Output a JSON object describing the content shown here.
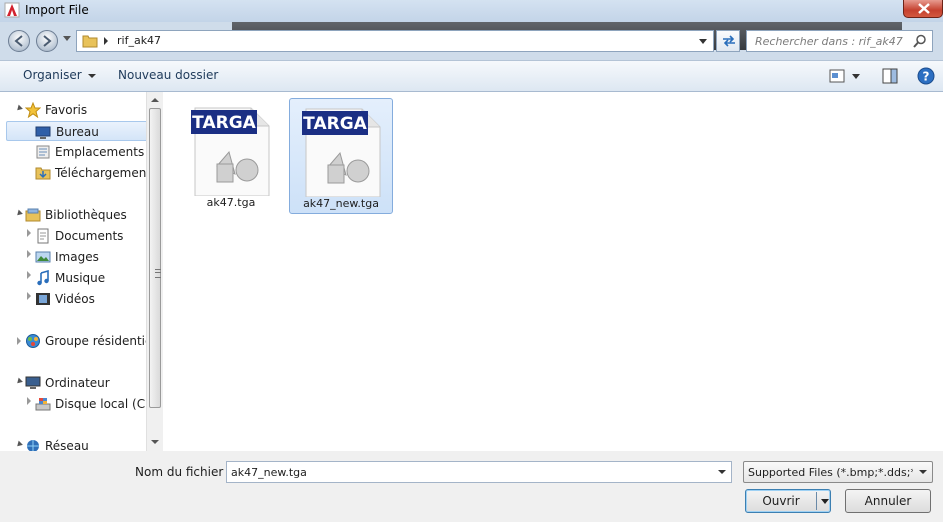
{
  "window": {
    "title": "Import File",
    "accent_color": "#cfdcea",
    "close_icon": "close-icon"
  },
  "address": {
    "path": "rif_ak47",
    "search_placeholder": "Rechercher dans : rif_ak47"
  },
  "toolbar": {
    "organize_label": "Organiser",
    "new_folder_label": "Nouveau dossier"
  },
  "navigation": {
    "favorites": {
      "label": "Favoris",
      "items": [
        {
          "label": "Bureau",
          "icon": "desktop-icon",
          "selected": true
        },
        {
          "label": "Emplacements ré",
          "icon": "places-icon"
        },
        {
          "label": "Téléchargements",
          "icon": "downloads-folder-icon"
        }
      ]
    },
    "libraries": {
      "label": "Bibliothèques",
      "items": [
        {
          "label": "Documents",
          "icon": "documents-icon"
        },
        {
          "label": "Images",
          "icon": "images-icon"
        },
        {
          "label": "Musique",
          "icon": "music-icon"
        },
        {
          "label": "Vidéos",
          "icon": "videos-icon"
        }
      ]
    },
    "homegroup": {
      "label": "Groupe résidentiel"
    },
    "computer": {
      "label": "Ordinateur",
      "items": [
        {
          "label": "Disque local (C:)",
          "icon": "local-disk-icon"
        }
      ]
    },
    "network": {
      "label": "Réseau"
    }
  },
  "files": [
    {
      "name": "ak47.tga",
      "badge": "TARGA",
      "selected": false
    },
    {
      "name": "ak47_new.tga",
      "badge": "TARGA",
      "selected": true
    }
  ],
  "footer": {
    "filename_label": "Nom du fichier :",
    "filename_value": "ak47_new.tga",
    "filter_value": "Supported Files (*.bmp;*.dds;*.dd",
    "open_label": "Ouvrir",
    "cancel_label": "Annuler"
  }
}
